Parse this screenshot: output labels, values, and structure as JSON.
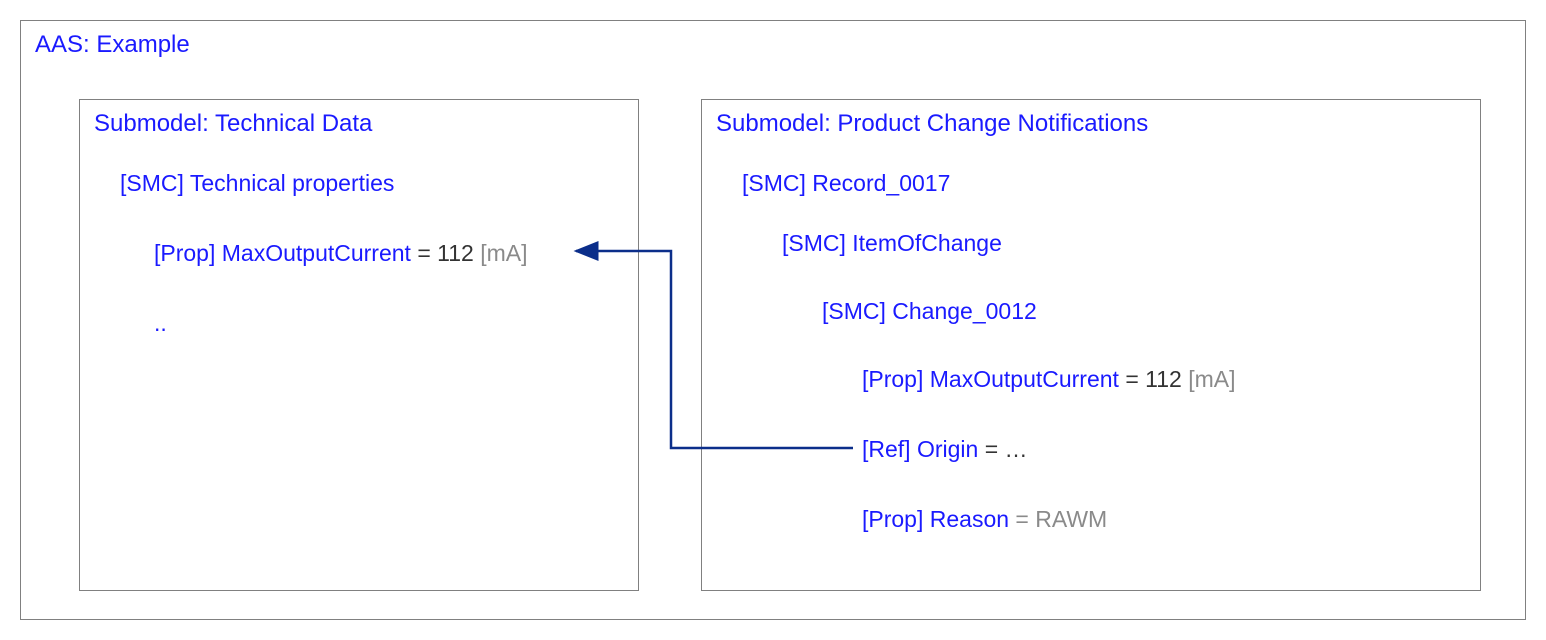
{
  "aas": {
    "title": "AAS: Example"
  },
  "submodelLeft": {
    "title": "Submodel: Technical Data",
    "smc1": "[SMC] Technical properties",
    "prop1_prefix": "[Prop] MaxOutputCurrent",
    "prop1_eq": " = ",
    "prop1_value": "112",
    "prop1_unit": " [mA]",
    "ellipsis": ".."
  },
  "submodelRight": {
    "title": "Submodel: Product Change Notifications",
    "l1": "[SMC] Record_0017",
    "l2": "[SMC] ItemOfChange",
    "l3": "[SMC] Change_0012",
    "l4_prefix": "[Prop] MaxOutputCurrent",
    "l4_eq": " = ",
    "l4_value": "112",
    "l4_unit": " [mA]",
    "l5_prefix": "[Ref] Origin",
    "l5_eq": " = ",
    "l5_value": "…",
    "l6_prefix": "[Prop] Reason",
    "l6_eq": " = ",
    "l6_value": "RAWM"
  },
  "colors": {
    "link": "#0b2e8a",
    "text": "#1a1aff",
    "gray": "#8a8a8a",
    "value": "#333333",
    "border": "#808080"
  }
}
